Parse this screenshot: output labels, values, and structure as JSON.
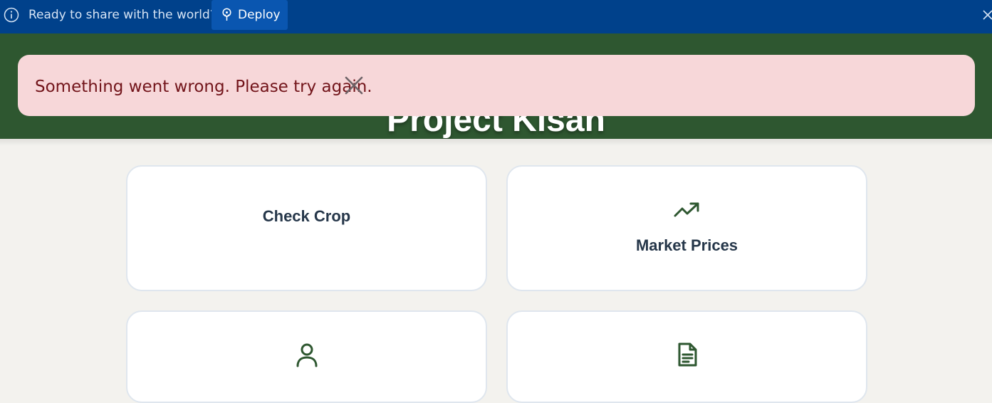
{
  "banner": {
    "info_icon": "info-icon",
    "text": "Ready to share with the world?",
    "deploy_label": "Deploy",
    "deploy_icon": "deploy-icon",
    "close_icon": "close-icon"
  },
  "header": {
    "title": "Project Kisan",
    "background_color": "#2e5730"
  },
  "toast": {
    "message": "Something went wrong. Please try again.",
    "close_icon": "close-icon",
    "background_color": "#f7d7d9",
    "text_color": "#72141a"
  },
  "cards": [
    {
      "label": "Check Crop",
      "icon": ""
    },
    {
      "label": "Market Prices",
      "icon": "trending-up-icon"
    },
    {
      "label": "",
      "icon": "user-icon"
    },
    {
      "label": "",
      "icon": "document-icon"
    }
  ],
  "colors": {
    "accent_green": "#2e5730",
    "topbar_blue": "#00418b"
  }
}
